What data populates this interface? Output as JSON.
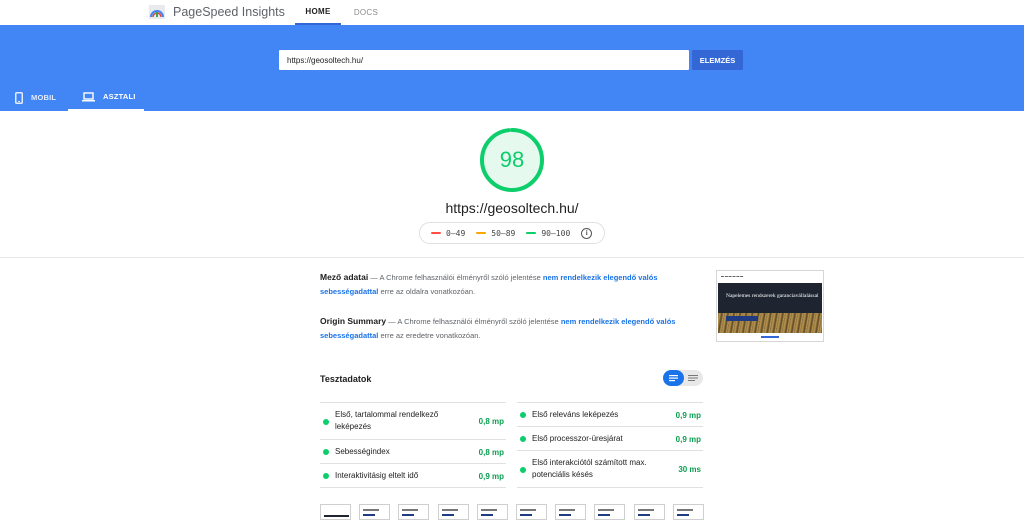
{
  "app": {
    "brand": "PageSpeed Insights",
    "nav": [
      {
        "label": "HOME",
        "active": true
      },
      {
        "label": "DOCS",
        "active": false
      }
    ]
  },
  "search": {
    "value": "https://geosoltech.hu/",
    "button_label": "ELEMZÉS"
  },
  "device_tabs": [
    {
      "label": "MOBIL",
      "active": false,
      "icon": "smartphone-icon"
    },
    {
      "label": "ASZTALI",
      "active": true,
      "icon": "laptop-icon"
    }
  ],
  "score": {
    "value": 98,
    "fraction": 0.98,
    "color": "#0cce6b",
    "tested_url": "https://geosoltech.hu/"
  },
  "legend": [
    {
      "range": "0–49",
      "color": "#ff4e42"
    },
    {
      "range": "50–89",
      "color": "#ffa400"
    },
    {
      "range": "90–100",
      "color": "#0cce6b"
    }
  ],
  "field_data": {
    "title": "Mező adatai",
    "prefix": " — A Chrome felhasználói élményről szóló jelentése ",
    "link": "nem rendelkezik elegendő valós sebességadattal",
    "suffix": " erre az oldalra vonatkozóan."
  },
  "origin_summary": {
    "title": "Origin Summary",
    "prefix": " — A Chrome felhasználói élményről szóló jelentése ",
    "link": "nem rendelkezik elegendő valós sebességadattal",
    "suffix": " erre az eredetre vonatkozóan."
  },
  "thumbnail": {
    "headline": "Napelemes rendszerek garanciavállalással"
  },
  "lab": {
    "title": "Tesztadatok",
    "metrics_left": [
      {
        "label": "Első, tartalommal rendelkező leképezés",
        "value": "0,8 mp"
      },
      {
        "label": "Sebességindex",
        "value": "0,8 mp"
      },
      {
        "label": "Interaktivitásig eltelt idő",
        "value": "0,9 mp"
      }
    ],
    "metrics_right": [
      {
        "label": "Első releváns leképezés",
        "value": "0,9 mp"
      },
      {
        "label": "Első processzor-üresjárat",
        "value": "0,9 mp"
      },
      {
        "label": "Első interakciótól számított max. potenciális késés",
        "value": "30 ms"
      }
    ]
  }
}
